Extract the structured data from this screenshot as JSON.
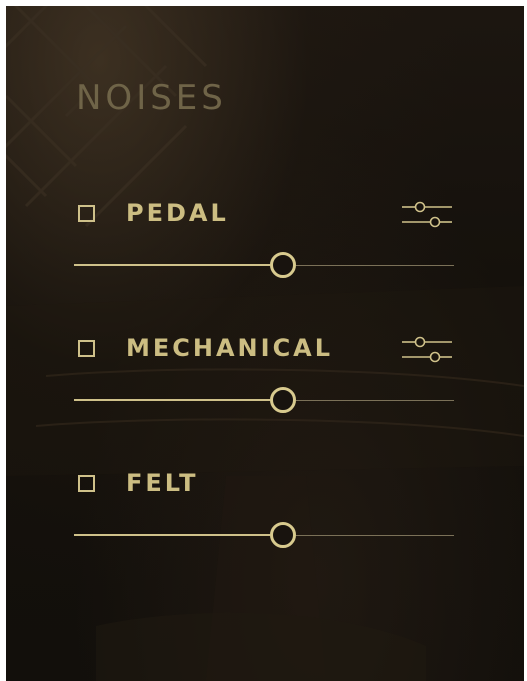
{
  "panel": {
    "title": "NOISES",
    "colors": {
      "accent": "#cfc18a",
      "title": "#6f6448",
      "background": "#15110c",
      "track_inactive": "#7b7158"
    }
  },
  "noises": [
    {
      "label": "PEDAL",
      "checked": false,
      "has_settings": true,
      "settings_icon": "sliders-icon",
      "slider_level": 0.55
    },
    {
      "label": "MECHANICAL",
      "checked": false,
      "has_settings": true,
      "settings_icon": "sliders-icon",
      "slider_level": 0.55
    },
    {
      "label": "FELT",
      "checked": false,
      "has_settings": false,
      "slider_level": 0.55
    }
  ]
}
